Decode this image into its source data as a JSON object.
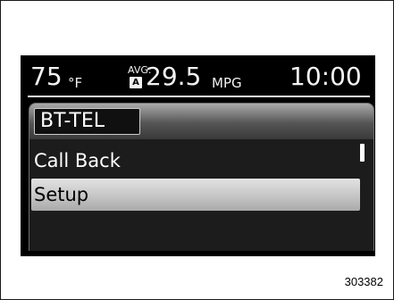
{
  "status_bar": {
    "temperature": "75",
    "temperature_unit": "°F",
    "avg_label": "AVG.",
    "avg_mode": "A",
    "fuel_economy": "29.5",
    "fuel_economy_unit": "MPG",
    "clock": "10:00"
  },
  "menu": {
    "title": "BT-TEL",
    "items": [
      {
        "label": "Call Back"
      },
      {
        "label": "Setup"
      }
    ]
  },
  "figure_number": "303382"
}
